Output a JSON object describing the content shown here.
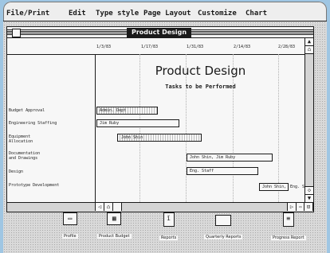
{
  "menu": {
    "items": [
      "File/Print",
      "Edit",
      "Type style",
      "Page Layout",
      "Customize",
      "Chart"
    ]
  },
  "window": {
    "title": "Product Design"
  },
  "timeline": {
    "dates": [
      "1/3/83",
      "1/17/83",
      "1/31/83",
      "2/14/83",
      "2/28/83"
    ]
  },
  "chart": {
    "title": "Product Design",
    "subtitle": "Tasks to be Performed"
  },
  "tasks": [
    {
      "name": "Budget Approval",
      "bar_label": "Admin. Dept",
      "after": ""
    },
    {
      "name": "Engineering Staffing",
      "bar_label": "Jim Ruby",
      "after": ""
    },
    {
      "name": "Equipment\nAllocation",
      "bar_label": "John Shin",
      "after": ""
    },
    {
      "name": "Documentation\nand Drawings",
      "bar_label": "John Shin, Jim Ruby",
      "after": ""
    },
    {
      "name": "Design",
      "bar_label": "Eng. Staff",
      "after": ""
    },
    {
      "name": "Prototype Development",
      "bar_label": "John Shin,",
      "after": "Eng. Staff"
    }
  ],
  "desktop": {
    "icons": [
      {
        "label": "Profile",
        "icon": "drive-icon"
      },
      {
        "label": "Product Budget",
        "icon": "spreadsheet-icon"
      },
      {
        "label": "Reports",
        "icon": "document-icon"
      },
      {
        "label": "Quarterly Reports",
        "icon": "folder-icon"
      },
      {
        "label": "Progress Report",
        "icon": "document-icon"
      }
    ]
  }
}
